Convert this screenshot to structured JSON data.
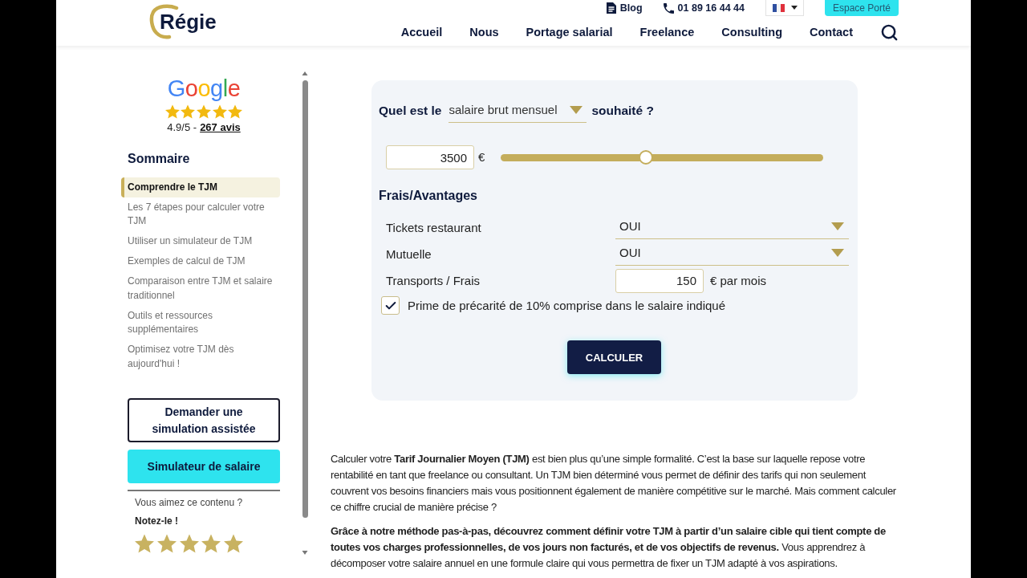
{
  "header": {
    "logo": "Régie",
    "links": [
      {
        "kind": "blog",
        "label": "Blog"
      },
      {
        "kind": "phone",
        "label": "01 89 16 44 44"
      }
    ],
    "account_button": "Espace Porté",
    "nav": [
      "Accueil",
      "Nous",
      "Portage salarial",
      "Freelance",
      "Consulting",
      "Contact"
    ]
  },
  "sidebar": {
    "reviews": {
      "brand": "Google",
      "stars": 5,
      "score": "4.9/5 -",
      "link": "267 avis"
    },
    "toc_title": "Sommaire",
    "toc": [
      {
        "label": "Comprendre le TJM",
        "selected": true
      },
      {
        "label": "Les 7 étapes pour calculer votre TJM",
        "selected": false
      },
      {
        "label": "Utiliser un simulateur de TJM",
        "selected": false
      },
      {
        "label": "Exemples de calcul de TJM",
        "selected": false
      },
      {
        "label": "Comparaison entre TJM et salaire traditionnel",
        "selected": false
      },
      {
        "label": "Outils et ressources supplémentaires",
        "selected": false
      },
      {
        "label": "Optimisez votre TJM dès aujourd'hui !",
        "selected": false
      }
    ],
    "buttons": [
      {
        "kind": "outline",
        "label": "Demander une simulation assistée"
      },
      {
        "kind": "filled",
        "label": "Simulateur de salaire"
      }
    ],
    "feedback": {
      "question": "Vous aimez ce contenu ?",
      "prompt": "Notez-le !",
      "stars": 5
    }
  },
  "simulator": {
    "question_prefix": "Quel est le",
    "salary_type": "salaire brut mensuel",
    "question_suffix": "souhaité ?",
    "amount": {
      "value": "3500",
      "unit": "€"
    },
    "slider": {
      "level": 0.45
    },
    "section_title": "Frais/Avantages",
    "fields": [
      {
        "kind": "select",
        "label": "Tickets restaurant",
        "value": "OUI"
      },
      {
        "kind": "select",
        "label": "Mutuelle",
        "value": "OUI"
      },
      {
        "kind": "input",
        "label": "Transports / Frais",
        "value": "150",
        "unit": "€ par mois"
      }
    ],
    "checkbox": {
      "label": "Prime de précarité de 10% comprise dans le salaire indiqué",
      "checked": true
    },
    "submit": "CALCULER"
  },
  "article": {
    "paragraphs": [
      "Calculer votre **Tarif Journalier Moyen (TJM)** est bien plus qu’une simple formalité. C’est la base sur laquelle repose votre rentabilité en tant que freelance ou consultant. Un TJM bien déterminé vous permet de définir des tarifs qui non seulement couvrent vos besoins financiers mais vous positionnent également de manière compétitive sur le marché. Mais comment calculer ce chiffre crucial de manière précise ?",
      "**Grâce à notre méthode pas-à-pas, découvrez comment définir votre TJM à partir d’un salaire cible qui tient compte de toutes vos charges professionnelles, de vos jours non facturés, et de vos objectifs de revenus.** Vous apprendrez à décomposer votre salaire annuel en une formule claire qui vous permettra de fixer un TJM adapté à vos aspirations."
    ]
  }
}
